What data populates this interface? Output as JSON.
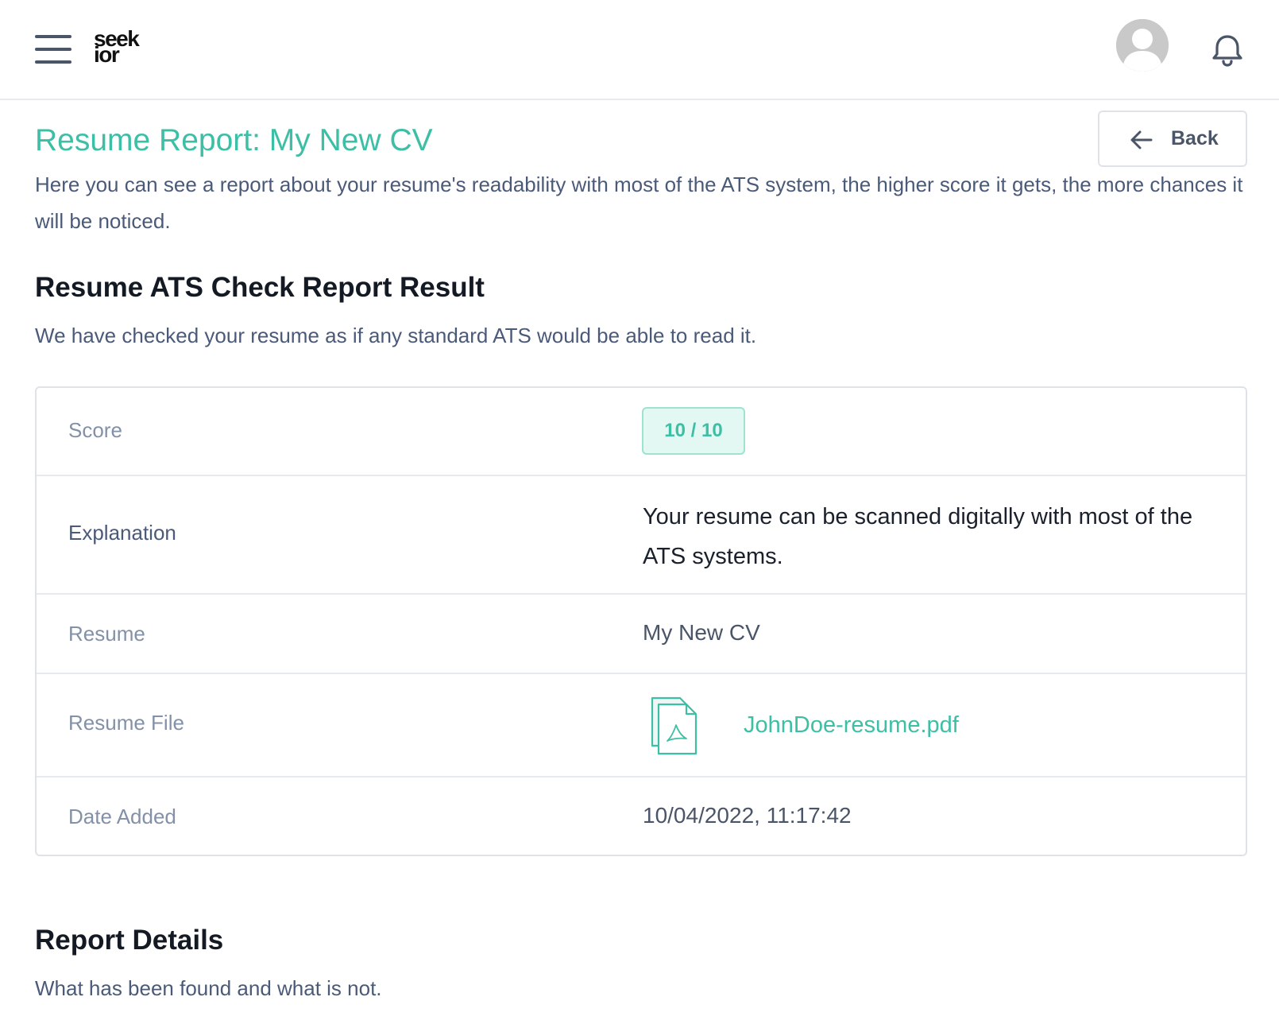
{
  "header": {
    "logo_line1": "seek",
    "logo_line2": "ior"
  },
  "page": {
    "title": "Resume Report: My New CV",
    "back_label": "Back",
    "intro": "Here you can see a report about your resume's readability with most of the ATS system, the higher score it gets, the more chances it will be noticed."
  },
  "ats_section": {
    "title": "Resume ATS Check Report Result",
    "subtitle": "We have checked your resume as if any standard ATS would be able to read it."
  },
  "report": {
    "score_label": "Score",
    "score_value": "10 / 10",
    "explanation_label": "Explanation",
    "explanation_value": "Your resume can be scanned digitally with most of the ATS systems.",
    "resume_label": "Resume",
    "resume_value": "My New CV",
    "file_label": "Resume File",
    "file_name": "JohnDoe-resume.pdf",
    "date_label": "Date Added",
    "date_value": "10/04/2022, 11:17:42"
  },
  "details_section": {
    "title": "Report Details",
    "subtitle": "What has been found and what is not."
  },
  "colors": {
    "accent": "#3dbfa5",
    "text_muted": "#8391a8",
    "text_body": "#4a5a78",
    "heading": "#141a23",
    "border": "#dfe3e9",
    "badge_bg": "#e3f8f2"
  },
  "icons": [
    "menu-icon",
    "user-avatar-icon",
    "bell-icon",
    "arrow-left-icon",
    "pdf-file-icon"
  ]
}
